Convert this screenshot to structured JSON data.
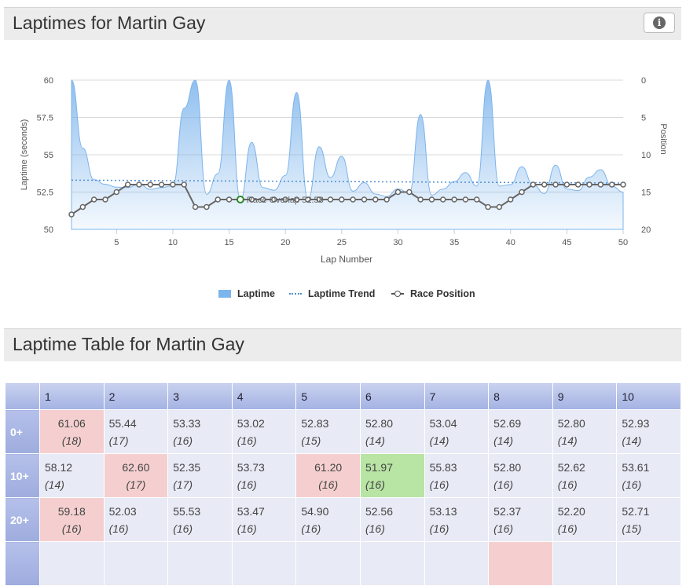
{
  "chart_panel": {
    "title": "Laptimes for Martin Gay",
    "info_icon": "info-icon"
  },
  "chart_data": {
    "type": "area",
    "title": "",
    "xlabel": "Lap Number",
    "ylabel": "Laptime (seconds)",
    "y2label": "Position",
    "xlim": [
      1,
      50
    ],
    "ylim": [
      50,
      60
    ],
    "y2lim": [
      0,
      20
    ],
    "y2_reversed": true,
    "x_ticks": [
      5,
      10,
      15,
      20,
      25,
      30,
      35,
      40,
      45,
      50
    ],
    "y_ticks": [
      50,
      52.5,
      55,
      57.5,
      60
    ],
    "y_tick_labels": [
      "50",
      "52.5",
      "55",
      "57.5",
      "60"
    ],
    "y2_ticks": [
      0,
      5,
      10,
      15,
      20
    ],
    "laps": [
      1,
      2,
      3,
      4,
      5,
      6,
      7,
      8,
      9,
      10,
      11,
      12,
      13,
      14,
      15,
      16,
      17,
      18,
      19,
      20,
      21,
      22,
      23,
      24,
      25,
      26,
      27,
      28,
      29,
      30,
      31,
      32,
      33,
      34,
      35,
      36,
      37,
      38,
      39,
      40,
      41,
      42,
      43,
      44,
      45,
      46,
      47,
      48,
      49,
      50
    ],
    "series": [
      {
        "name": "Laptime",
        "color": "#7cb4ec",
        "values": [
          61.06,
          55.44,
          53.33,
          53.02,
          52.83,
          52.8,
          53.04,
          52.69,
          52.8,
          52.93,
          58.12,
          62.6,
          52.35,
          53.73,
          61.2,
          51.97,
          55.83,
          52.8,
          52.62,
          53.61,
          59.18,
          52.03,
          55.53,
          53.47,
          54.9,
          52.56,
          53.13,
          52.37,
          52.2,
          52.71,
          52.45,
          57.7,
          52.3,
          52.7,
          53.2,
          53.8,
          52.9,
          62.8,
          52.9,
          53.0,
          54.2,
          53.0,
          52.4,
          54.3,
          52.7,
          52.6,
          53.5,
          54.0,
          52.9,
          52.5
        ]
      },
      {
        "name": "Laptime Trend",
        "color": "#4f8fd0",
        "values": [
          53.3,
          53.1
        ]
      },
      {
        "name": "Race Position",
        "color": "#555555",
        "values": [
          18,
          17,
          16,
          16,
          15,
          14,
          14,
          14,
          14,
          14,
          14,
          17,
          17,
          16,
          16,
          16,
          16,
          16,
          16,
          16,
          16,
          16,
          16,
          16,
          16,
          16,
          16,
          16,
          16,
          15,
          15,
          16,
          16,
          16,
          16,
          16,
          16,
          17,
          17,
          16,
          15,
          14,
          14,
          14,
          14,
          14,
          14,
          14,
          14,
          14
        ]
      }
    ],
    "overlay_label": "Race Overlap 52.58",
    "legend": [
      "Laptime",
      "Laptime Trend",
      "Race Position"
    ],
    "legend_position": "bottom"
  },
  "table_panel": {
    "title": "Laptime Table for Martin Gay"
  },
  "table": {
    "columns": [
      "1",
      "2",
      "3",
      "4",
      "5",
      "6",
      "7",
      "8",
      "9",
      "10"
    ],
    "rows": [
      {
        "label": "0+",
        "cells": [
          {
            "time": "61.06",
            "pos": "(18)",
            "status": "slow"
          },
          {
            "time": "55.44",
            "pos": "(17)",
            "status": ""
          },
          {
            "time": "53.33",
            "pos": "(16)",
            "status": ""
          },
          {
            "time": "53.02",
            "pos": "(16)",
            "status": ""
          },
          {
            "time": "52.83",
            "pos": "(15)",
            "status": ""
          },
          {
            "time": "52.80",
            "pos": "(14)",
            "status": ""
          },
          {
            "time": "53.04",
            "pos": "(14)",
            "status": ""
          },
          {
            "time": "52.69",
            "pos": "(14)",
            "status": ""
          },
          {
            "time": "52.80",
            "pos": "(14)",
            "status": ""
          },
          {
            "time": "52.93",
            "pos": "(14)",
            "status": ""
          }
        ]
      },
      {
        "label": "10+",
        "cells": [
          {
            "time": "58.12",
            "pos": "(14)",
            "status": ""
          },
          {
            "time": "62.60",
            "pos": "(17)",
            "status": "slow"
          },
          {
            "time": "52.35",
            "pos": "(17)",
            "status": ""
          },
          {
            "time": "53.73",
            "pos": "(16)",
            "status": ""
          },
          {
            "time": "61.20",
            "pos": "(16)",
            "status": "slow"
          },
          {
            "time": "51.97",
            "pos": "(16)",
            "status": "fast"
          },
          {
            "time": "55.83",
            "pos": "(16)",
            "status": ""
          },
          {
            "time": "52.80",
            "pos": "(16)",
            "status": ""
          },
          {
            "time": "52.62",
            "pos": "(16)",
            "status": ""
          },
          {
            "time": "53.61",
            "pos": "(16)",
            "status": ""
          }
        ]
      },
      {
        "label": "20+",
        "cells": [
          {
            "time": "59.18",
            "pos": "(16)",
            "status": "slow"
          },
          {
            "time": "52.03",
            "pos": "(16)",
            "status": ""
          },
          {
            "time": "55.53",
            "pos": "(16)",
            "status": ""
          },
          {
            "time": "53.47",
            "pos": "(16)",
            "status": ""
          },
          {
            "time": "54.90",
            "pos": "(16)",
            "status": ""
          },
          {
            "time": "52.56",
            "pos": "(16)",
            "status": ""
          },
          {
            "time": "53.13",
            "pos": "(16)",
            "status": ""
          },
          {
            "time": "52.37",
            "pos": "(16)",
            "status": ""
          },
          {
            "time": "52.20",
            "pos": "(16)",
            "status": ""
          },
          {
            "time": "52.71",
            "pos": "(15)",
            "status": ""
          }
        ]
      },
      {
        "label": "",
        "cells": [
          {
            "time": "",
            "pos": "",
            "status": ""
          },
          {
            "time": "",
            "pos": "",
            "status": ""
          },
          {
            "time": "",
            "pos": "",
            "status": ""
          },
          {
            "time": "",
            "pos": "",
            "status": ""
          },
          {
            "time": "",
            "pos": "",
            "status": ""
          },
          {
            "time": "",
            "pos": "",
            "status": ""
          },
          {
            "time": "",
            "pos": "",
            "status": ""
          },
          {
            "time": "",
            "pos": "",
            "status": "slow"
          },
          {
            "time": "",
            "pos": "",
            "status": ""
          },
          {
            "time": "",
            "pos": "",
            "status": ""
          }
        ]
      }
    ]
  }
}
